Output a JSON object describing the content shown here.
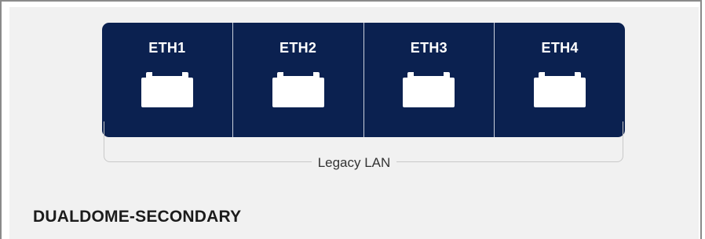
{
  "ports": [
    {
      "label": "ETH1",
      "icon": "ethernet-port-icon"
    },
    {
      "label": "ETH2",
      "icon": "ethernet-port-icon"
    },
    {
      "label": "ETH3",
      "icon": "ethernet-port-icon"
    },
    {
      "label": "ETH4",
      "icon": "ethernet-port-icon"
    }
  ],
  "group_label": "Legacy LAN",
  "device_name": "DUALDOME-SECONDARY",
  "colors": {
    "port_block": "#0b2150",
    "panel_bg": "#f1f1f1",
    "port_icon": "#ffffff"
  }
}
